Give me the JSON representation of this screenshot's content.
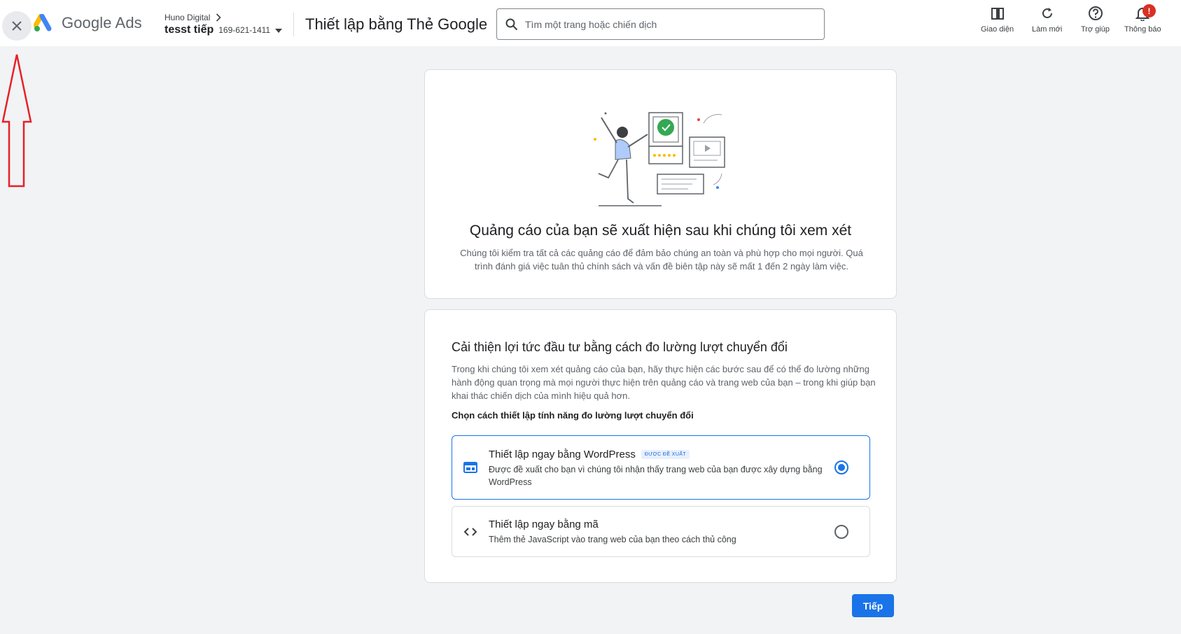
{
  "header": {
    "close_icon": "close-icon",
    "logo_text": "Google Ads",
    "account": {
      "parent": "Huno Digital",
      "name": "tesst tiếp",
      "id": "169-621-1411"
    },
    "page_title": "Thiết lập bằng Thẻ Google",
    "search": {
      "placeholder": "Tìm một trang hoặc chiến dịch"
    },
    "tools": [
      {
        "label": "Giao diện",
        "icon": "appearance-icon"
      },
      {
        "label": "Làm mới",
        "icon": "refresh-icon"
      },
      {
        "label": "Trợ giúp",
        "icon": "help-icon"
      },
      {
        "label": "Thông báo",
        "icon": "notifications-icon",
        "badge": "!"
      }
    ]
  },
  "review_card": {
    "title": "Quảng cáo của bạn sẽ xuất hiện sau khi chúng tôi xem xét",
    "description": "Chúng tôi kiểm tra tất cả các quảng cáo để đảm bảo chúng an toàn và phù hợp cho mọi người. Quá trình đánh giá việc tuân thủ chính sách và vấn đề biên tập này sẽ mất 1 đến 2 ngày làm việc."
  },
  "conversion_card": {
    "title": "Cải thiện lợi tức đầu tư bằng cách đo lường lượt chuyển đổi",
    "description": "Trong khi chúng tôi xem xét quảng cáo của bạn, hãy thực hiện các bước sau để có thể đo lường những hành động quan trọng mà mọi người thực hiện trên quảng cáo và trang web của bạn – trong khi giúp bạn khai thác chiến dịch của mình hiệu quả hơn.",
    "choose_label": "Chọn cách thiết lập tính năng đo lường lượt chuyển đổi",
    "options": [
      {
        "title": "Thiết lập ngay bằng WordPress",
        "badge": "Được đề xuất",
        "description": "Được đề xuất cho bạn vì chúng tôi nhận thấy trang web của bạn được xây dựng bằng WordPress",
        "selected": true,
        "icon": "web-layout-icon"
      },
      {
        "title": "Thiết lập ngay bằng mã",
        "description": "Thêm thẻ JavaScript vào trang web của bạn theo cách thủ công",
        "selected": false,
        "icon": "code-icon"
      }
    ]
  },
  "footer": {
    "next_label": "Tiếp"
  },
  "colors": {
    "accent": "#1a73e8",
    "annotation": "#e8202a",
    "badge": "#d93025"
  }
}
